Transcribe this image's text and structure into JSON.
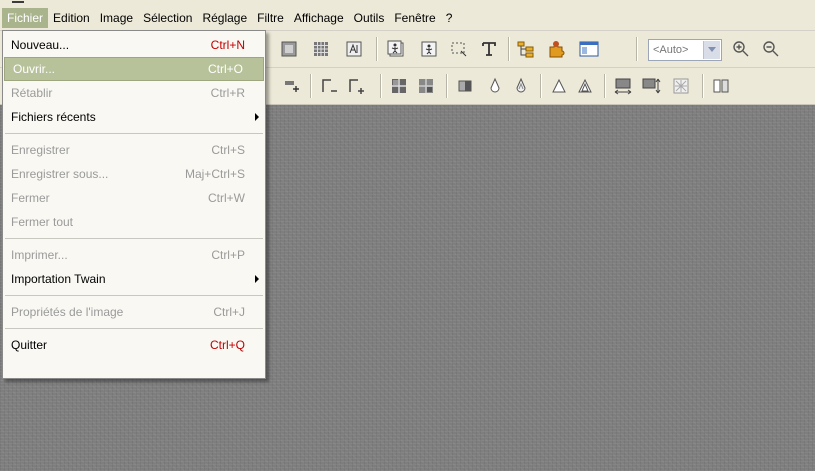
{
  "menubar": {
    "items": [
      "Fichier",
      "Edition",
      "Image",
      "Sélection",
      "Réglage",
      "Filtre",
      "Affichage",
      "Outils",
      "Fenêtre",
      "?"
    ]
  },
  "toolbar": {
    "zoom_select": {
      "value": "<Auto>"
    }
  },
  "file_menu": {
    "items": [
      {
        "label": "Nouveau...",
        "shortcut": "Ctrl+N",
        "disabled": false
      },
      {
        "label": "Ouvrir...",
        "shortcut": "Ctrl+O",
        "disabled": false,
        "highlighted": true
      },
      {
        "label": "Rétablir",
        "shortcut": "Ctrl+R",
        "disabled": true
      },
      {
        "label": "Fichiers récents",
        "shortcut": "",
        "disabled": false,
        "submenu": true
      },
      {
        "label": "Enregistrer",
        "shortcut": "Ctrl+S",
        "disabled": true
      },
      {
        "label": "Enregistrer sous...",
        "shortcut": "Maj+Ctrl+S",
        "disabled": true
      },
      {
        "label": "Fermer",
        "shortcut": "Ctrl+W",
        "disabled": true
      },
      {
        "label": "Fermer tout",
        "shortcut": "",
        "disabled": true
      },
      {
        "label": "Imprimer...",
        "shortcut": "Ctrl+P",
        "disabled": true
      },
      {
        "label": "Importation Twain",
        "shortcut": "",
        "disabled": false,
        "submenu": true
      },
      {
        "label": "Propriétés de l'image",
        "shortcut": "Ctrl+J",
        "disabled": true
      },
      {
        "label": "Quitter",
        "shortcut": "Ctrl+Q",
        "disabled": false
      }
    ]
  },
  "colors": {
    "menu_highlight": "#a9b38c",
    "shortcut_red": "#c00000",
    "workspace": "#7e7e7e"
  }
}
